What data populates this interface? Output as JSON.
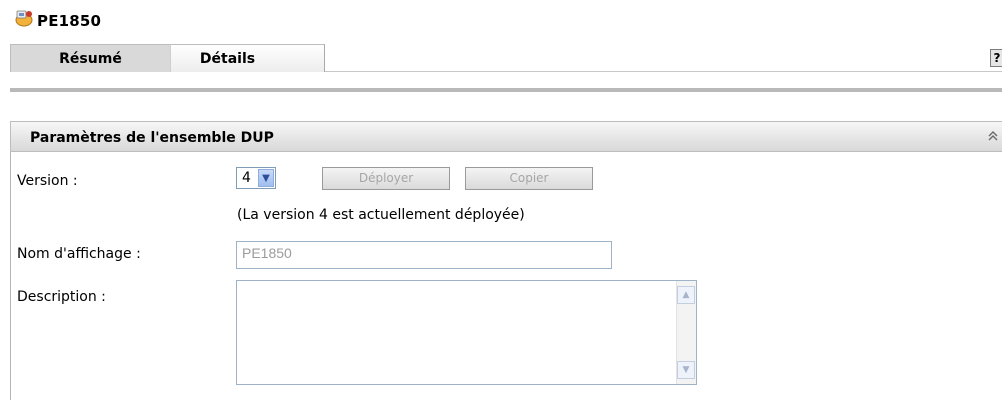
{
  "header": {
    "title": "PE1850",
    "icon": "bundle-icon"
  },
  "tabs": [
    {
      "label": "Résumé"
    },
    {
      "label": "Détails"
    }
  ],
  "help": {
    "label": "?"
  },
  "panel": {
    "title": "Paramètres de l'ensemble DUP",
    "collapse_icon": "double-chevron-up-icon"
  },
  "form": {
    "version_label": "Version :",
    "version_value": "4",
    "deploy_label": "Déployer",
    "copy_label": "Copier",
    "deployed_note": "(La version 4 est actuellement déployée)",
    "display_name_label": "Nom d'affichage :",
    "display_name_value": "PE1850",
    "description_label": "Description :",
    "description_value": ""
  },
  "colors": {
    "tab_selected": "#d9d9d9",
    "select_arrow": "#9fbdf0",
    "disabled_text": "#a6a6a6"
  }
}
